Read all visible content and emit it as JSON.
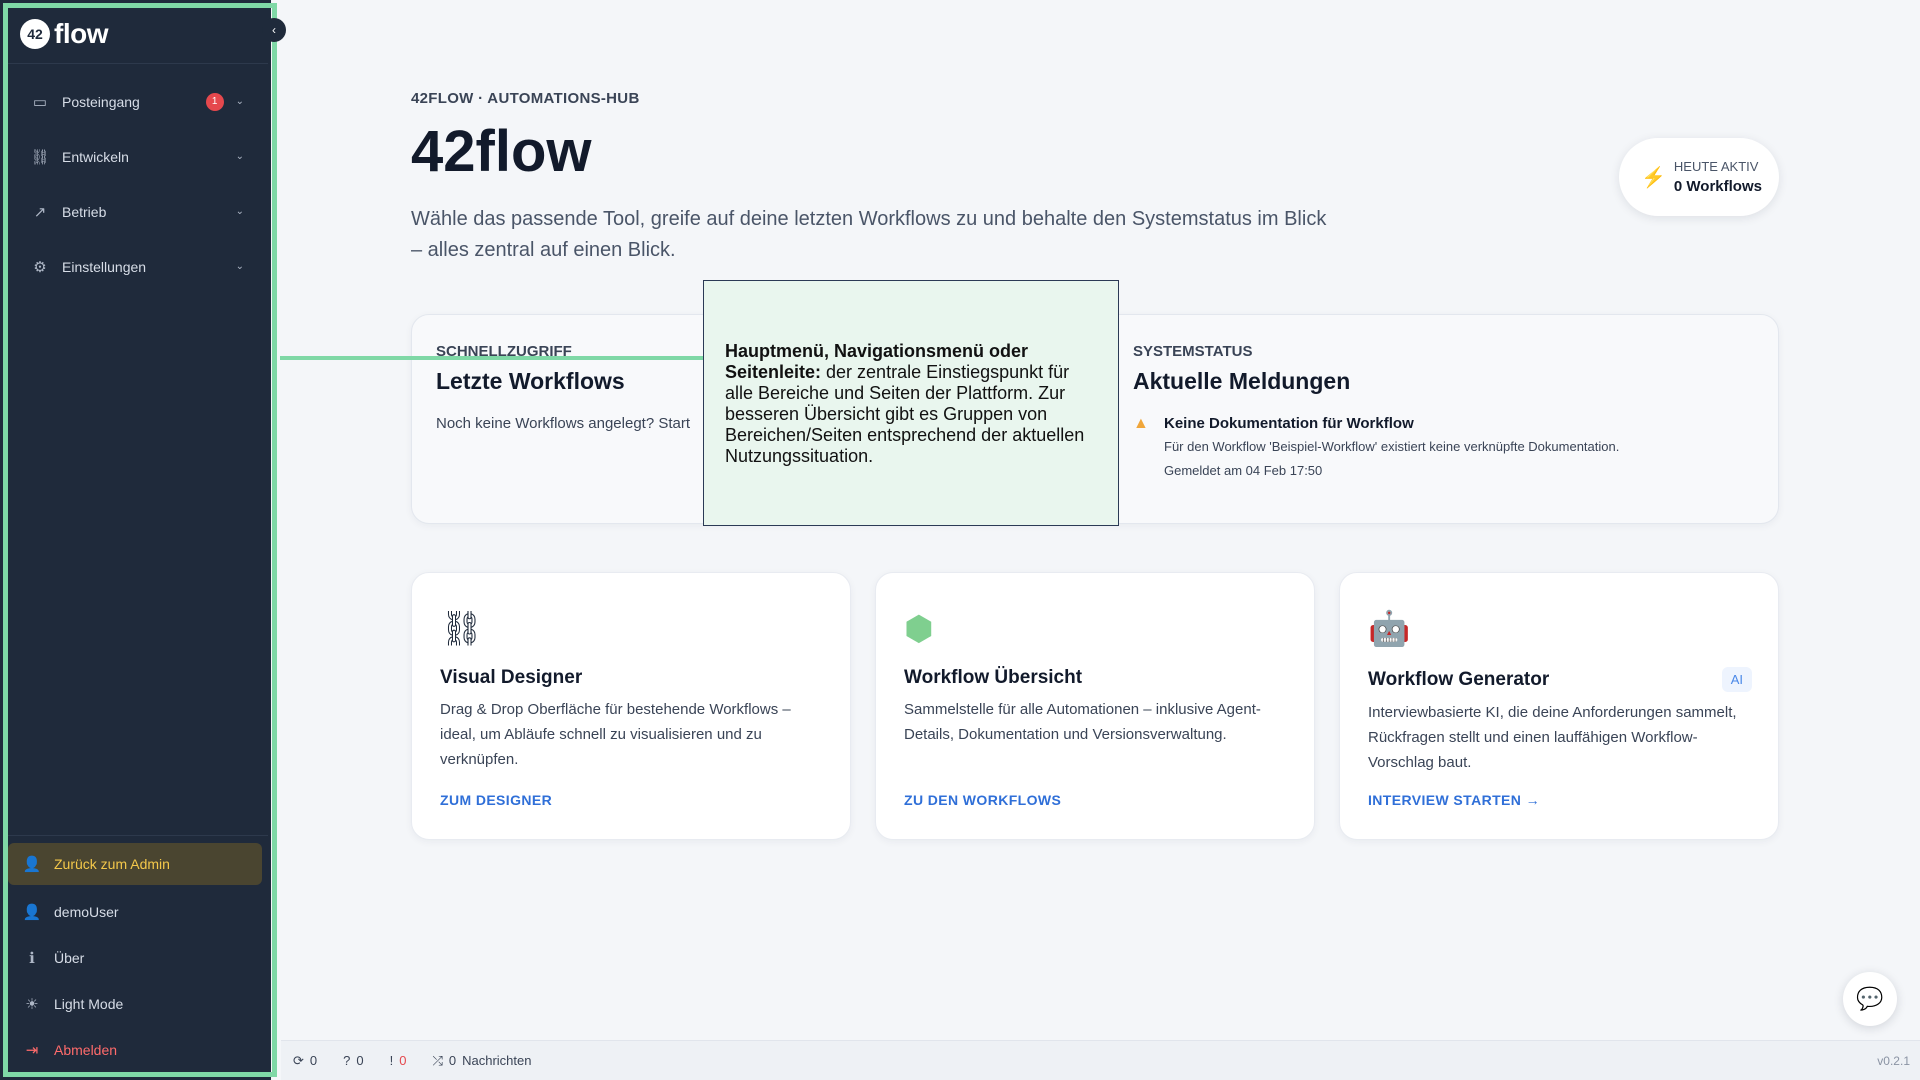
{
  "sidebar": {
    "logo_mark": "42",
    "logo_text": "flow",
    "collapse_icon": "‹",
    "items": [
      {
        "label": "Posteingang",
        "icon": "inbox-icon",
        "badge": "1"
      },
      {
        "label": "Entwickeln",
        "icon": "workflow-icon"
      },
      {
        "label": "Betrieb",
        "icon": "chart-line-icon"
      },
      {
        "label": "Einstellungen",
        "icon": "gears-icon"
      }
    ],
    "bottom": {
      "admin": "Zurück zum Admin",
      "user": "demoUser",
      "about": "Über",
      "light_mode": "Light Mode",
      "logout": "Abmelden"
    }
  },
  "header": {
    "kicker": "42FLOW · AUTOMATIONS-HUB",
    "title": "42flow",
    "subtitle": "Wähle das passende Tool, greife auf deine letzten Workflows zu und behalte den Systemstatus im Blick – alles zentral auf einen Blick.",
    "active": {
      "label": "HEUTE AKTIV",
      "value": "0 Workflows"
    }
  },
  "quick": {
    "kicker": "SCHNELLZUGRIFF",
    "title": "Letzte Workflows",
    "text": "Noch keine Workflows angelegt? Start"
  },
  "status": {
    "kicker": "SYSTEMSTATUS",
    "title": "Aktuelle Meldungen",
    "message_title": "Keine Dokumentation für Workflow",
    "message_text": "Für den Workflow 'Beispiel-Workflow' existiert keine verknüpfte Dokumentation.",
    "message_date": "Gemeldet am 04 Feb 17:50"
  },
  "tools": [
    {
      "title": "Visual Designer",
      "desc": "Drag & Drop Oberfläche für bestehende Workflows – ideal, um Abläufe schnell zu visualisieren und zu verknüpfen.",
      "link": "ZUM DESIGNER",
      "icon": "diagram-icon"
    },
    {
      "title": "Workflow Übersicht",
      "desc": "Sammelstelle für alle Automationen – inklusive Agent-Details, Dokumentation und Versionsverwaltung.",
      "link": "ZU DEN WORKFLOWS",
      "icon": "cubes-icon"
    },
    {
      "title": "Workflow Generator",
      "desc": "Interviewbasierte KI, die deine Anforderungen sammelt, Rückfragen stellt und einen lauffähigen Workflow-Vorschlag baut.",
      "link": "INTERVIEW STARTEN →",
      "icon": "robot-icon",
      "badge": "AI"
    }
  ],
  "tooltip": {
    "bold": "Hauptmenü, Navigationsmenü oder Seitenleite:",
    "text": " der zentrale Einstiegspunkt für alle Bereiche und Seiten der Plattform. Zur besseren Übersicht gibt es Gruppen von Bereichen/Seiten entsprechend der aktuellen Nutzungssituation."
  },
  "statusbar": {
    "sync": "0",
    "questions": "0",
    "errors": "0",
    "messages_count": "0",
    "messages_label": "Nachrichten",
    "version": "v0.2.1"
  },
  "colors": {
    "sidebar_bg": "#1f2a3b",
    "highlight": "#7fd8a6",
    "accent_link": "#2f6fd8",
    "warning": "#f0a63a",
    "error": "#e5484d"
  }
}
